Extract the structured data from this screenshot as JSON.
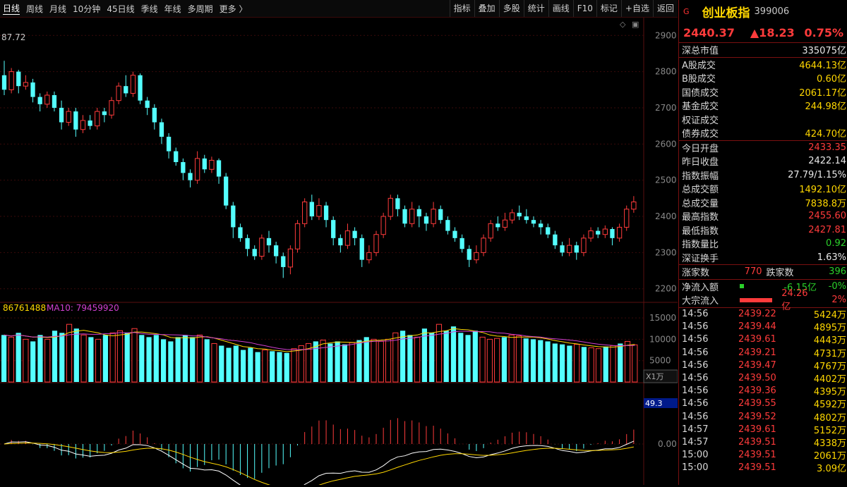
{
  "toolbar": {
    "periods": [
      "日线",
      "周线",
      "月线",
      "10分钟",
      "45日线",
      "季线",
      "年线",
      "多周期",
      "更多 〉"
    ],
    "active_period": "日线",
    "buttons": [
      "指标",
      "叠加",
      "多股",
      "统计",
      "画线",
      "F10",
      "标记",
      "+自选",
      "返回"
    ]
  },
  "chart": {
    "price_max_label": "87.72",
    "price_axis": [
      "2900",
      "2800",
      "2700",
      "2600",
      "2500",
      "2400",
      "2300",
      "2200"
    ],
    "volume_label": "86761488",
    "ma10_label": "MA10: 79459920",
    "volume_axis": [
      "15000",
      "10000",
      "5000"
    ],
    "volume_unit": "X1万",
    "macd_value_box": "49.3",
    "macd_zero": "0.00",
    "colors": {
      "up": "#ff3b3b",
      "down": "#54ffff",
      "ma_yellow": "#ffd700",
      "ma_purple": "#d040d0",
      "grid": "#3a0a0a"
    }
  },
  "panel": {
    "badge": "G",
    "name": "创业板指",
    "code": "399006",
    "price": "2440.37",
    "change": "▲18.23",
    "change_pct": "0.75%",
    "market": [
      {
        "label": "深总市值",
        "value": "335075亿",
        "color": "w"
      }
    ],
    "turnover": [
      {
        "label": "A股成交",
        "value": "4644.13亿"
      },
      {
        "label": "B股成交",
        "value": "0.60亿"
      },
      {
        "label": "国债成交",
        "value": "2061.17亿"
      },
      {
        "label": "基金成交",
        "value": "244.98亿"
      },
      {
        "label": "权证成交",
        "value": ""
      },
      {
        "label": "债券成交",
        "value": "424.70亿"
      }
    ],
    "quote": [
      {
        "label": "今日开盘",
        "value": "2433.35",
        "color": "r"
      },
      {
        "label": "昨日收盘",
        "value": "2422.14",
        "color": "w"
      },
      {
        "label": "指数振幅",
        "value": "27.79/1.15%",
        "color": "w"
      },
      {
        "label": "总成交额",
        "value": "1492.10亿",
        "color": "y"
      },
      {
        "label": "总成交量",
        "value": "7838.8万",
        "color": "y"
      },
      {
        "label": "最高指数",
        "value": "2455.60",
        "color": "r"
      },
      {
        "label": "最低指数",
        "value": "2427.81",
        "color": "r"
      },
      {
        "label": "指数量比",
        "value": "0.92",
        "color": "g"
      },
      {
        "label": "深证换手",
        "value": "1.63%",
        "color": "w"
      }
    ],
    "breadth": {
      "up_label": "涨家数",
      "up_value": "770",
      "down_label": "跌家数",
      "down_value": "396"
    },
    "flows": [
      {
        "label": "净流入额",
        "value": "-6.15亿",
        "pct": "-0%",
        "bar_color": "#2ad02a",
        "bar_fraction": 0.1,
        "value_color": "g"
      },
      {
        "label": "大宗流入",
        "value": "24.26亿",
        "pct": "2%",
        "bar_color": "#ff3b3b",
        "bar_fraction": 0.72,
        "value_color": "r"
      }
    ],
    "ticks": [
      {
        "time": "14:56",
        "price": "2439.22",
        "vol": "5424万"
      },
      {
        "time": "14:56",
        "price": "2439.44",
        "vol": "4895万"
      },
      {
        "time": "14:56",
        "price": "2439.61",
        "vol": "4443万"
      },
      {
        "time": "14:56",
        "price": "2439.21",
        "vol": "4731万"
      },
      {
        "time": "14:56",
        "price": "2439.47",
        "vol": "4767万"
      },
      {
        "time": "14:56",
        "price": "2439.50",
        "vol": "4402万"
      },
      {
        "time": "14:56",
        "price": "2439.36",
        "vol": "4395万"
      },
      {
        "time": "14:56",
        "price": "2439.55",
        "vol": "4592万"
      },
      {
        "time": "14:56",
        "price": "2439.52",
        "vol": "4802万"
      },
      {
        "time": "14:57",
        "price": "2439.61",
        "vol": "5152万"
      },
      {
        "time": "14:57",
        "price": "2439.51",
        "vol": "4338万"
      },
      {
        "time": "15:00",
        "price": "2439.51",
        "vol": "2061万"
      },
      {
        "time": "15:00",
        "price": "2439.51",
        "vol": "3.09亿"
      }
    ]
  },
  "chart_data": {
    "type": "candlestick",
    "y_range": [
      2180,
      2920
    ],
    "candles": [
      [
        2790,
        2750,
        2830,
        2735
      ],
      [
        2750,
        2800,
        2810,
        2740
      ],
      [
        2800,
        2760,
        2805,
        2740
      ],
      [
        2760,
        2770,
        2790,
        2750
      ],
      [
        2770,
        2730,
        2780,
        2715
      ],
      [
        2730,
        2710,
        2740,
        2690
      ],
      [
        2710,
        2735,
        2745,
        2700
      ],
      [
        2735,
        2700,
        2745,
        2690
      ],
      [
        2700,
        2660,
        2720,
        2640
      ],
      [
        2660,
        2690,
        2700,
        2650
      ],
      [
        2690,
        2640,
        2700,
        2620
      ],
      [
        2640,
        2665,
        2680,
        2630
      ],
      [
        2665,
        2650,
        2680,
        2640
      ],
      [
        2650,
        2690,
        2700,
        2640
      ],
      [
        2690,
        2680,
        2700,
        2660
      ],
      [
        2680,
        2720,
        2730,
        2670
      ],
      [
        2720,
        2760,
        2770,
        2710
      ],
      [
        2760,
        2740,
        2790,
        2730
      ],
      [
        2740,
        2790,
        2800,
        2730
      ],
      [
        2790,
        2720,
        2795,
        2710
      ],
      [
        2720,
        2700,
        2730,
        2680
      ],
      [
        2700,
        2660,
        2710,
        2640
      ],
      [
        2660,
        2620,
        2670,
        2600
      ],
      [
        2620,
        2580,
        2630,
        2560
      ],
      [
        2580,
        2550,
        2590,
        2540
      ],
      [
        2550,
        2520,
        2560,
        2500
      ],
      [
        2520,
        2500,
        2530,
        2480
      ],
      [
        2500,
        2560,
        2580,
        2490
      ],
      [
        2560,
        2530,
        2570,
        2520
      ],
      [
        2530,
        2555,
        2565,
        2520
      ],
      [
        2555,
        2510,
        2560,
        2490
      ],
      [
        2510,
        2430,
        2520,
        2420
      ],
      [
        2430,
        2370,
        2440,
        2340
      ],
      [
        2370,
        2340,
        2380,
        2330
      ],
      [
        2340,
        2310,
        2350,
        2290
      ],
      [
        2310,
        2290,
        2320,
        2280
      ],
      [
        2290,
        2340,
        2350,
        2280
      ],
      [
        2340,
        2320,
        2360,
        2300
      ],
      [
        2320,
        2290,
        2330,
        2270
      ],
      [
        2290,
        2260,
        2300,
        2230
      ],
      [
        2260,
        2310,
        2320,
        2240
      ],
      [
        2310,
        2380,
        2390,
        2300
      ],
      [
        2380,
        2440,
        2450,
        2370
      ],
      [
        2440,
        2400,
        2460,
        2390
      ],
      [
        2400,
        2430,
        2450,
        2390
      ],
      [
        2430,
        2390,
        2440,
        2370
      ],
      [
        2390,
        2340,
        2400,
        2320
      ],
      [
        2340,
        2320,
        2350,
        2300
      ],
      [
        2320,
        2360,
        2380,
        2310
      ],
      [
        2360,
        2340,
        2370,
        2320
      ],
      [
        2340,
        2280,
        2350,
        2260
      ],
      [
        2280,
        2300,
        2320,
        2270
      ],
      [
        2300,
        2350,
        2360,
        2290
      ],
      [
        2350,
        2400,
        2410,
        2340
      ],
      [
        2400,
        2450,
        2460,
        2390
      ],
      [
        2450,
        2420,
        2460,
        2400
      ],
      [
        2420,
        2380,
        2430,
        2370
      ],
      [
        2380,
        2420,
        2440,
        2370
      ],
      [
        2420,
        2400,
        2430,
        2370
      ],
      [
        2400,
        2380,
        2410,
        2360
      ],
      [
        2380,
        2420,
        2440,
        2370
      ],
      [
        2420,
        2390,
        2430,
        2380
      ],
      [
        2390,
        2360,
        2400,
        2350
      ],
      [
        2360,
        2340,
        2370,
        2330
      ],
      [
        2340,
        2310,
        2350,
        2300
      ],
      [
        2310,
        2280,
        2320,
        2260
      ],
      [
        2280,
        2300,
        2320,
        2270
      ],
      [
        2300,
        2340,
        2350,
        2290
      ],
      [
        2340,
        2380,
        2390,
        2330
      ],
      [
        2380,
        2370,
        2400,
        2360
      ],
      [
        2370,
        2390,
        2410,
        2360
      ],
      [
        2390,
        2410,
        2420,
        2380
      ],
      [
        2410,
        2400,
        2430,
        2390
      ],
      [
        2400,
        2390,
        2420,
        2380
      ],
      [
        2390,
        2380,
        2400,
        2370
      ],
      [
        2380,
        2370,
        2390,
        2350
      ],
      [
        2370,
        2350,
        2380,
        2340
      ],
      [
        2350,
        2320,
        2360,
        2310
      ],
      [
        2320,
        2300,
        2330,
        2290
      ],
      [
        2300,
        2320,
        2340,
        2290
      ],
      [
        2320,
        2300,
        2330,
        2280
      ],
      [
        2300,
        2340,
        2350,
        2290
      ],
      [
        2340,
        2360,
        2370,
        2330
      ],
      [
        2360,
        2350,
        2370,
        2340
      ],
      [
        2350,
        2365,
        2375,
        2340
      ],
      [
        2365,
        2340,
        2370,
        2320
      ],
      [
        2340,
        2370,
        2380,
        2330
      ],
      [
        2370,
        2420,
        2430,
        2360
      ],
      [
        2420,
        2440,
        2456,
        2410
      ]
    ],
    "volume": [
      11000,
      10500,
      11500,
      10000,
      9500,
      11000,
      10000,
      12000,
      11500,
      13500,
      12500,
      11000,
      10500,
      10000,
      11000,
      11500,
      12000,
      11500,
      12500,
      11000,
      10500,
      11000,
      10000,
      9500,
      10500,
      11000,
      10500,
      11000,
      10000,
      9000,
      8500,
      8000,
      8500,
      7500,
      8000,
      7000,
      7500,
      7200,
      7000,
      6800,
      7800,
      8500,
      9000,
      9500,
      9800,
      9000,
      9500,
      8800,
      9200,
      9800,
      10500,
      10000,
      9500,
      10000,
      11500,
      12000,
      11000,
      10500,
      12500,
      11500,
      13500,
      12000,
      13000,
      11500,
      11000,
      12000,
      10500,
      10000,
      10200,
      10500,
      11000,
      10800,
      10200,
      10000,
      9800,
      9500,
      9000,
      8800,
      8500,
      8800,
      8200,
      8000,
      7800,
      8300,
      8500,
      9000,
      9500,
      8700
    ]
  }
}
